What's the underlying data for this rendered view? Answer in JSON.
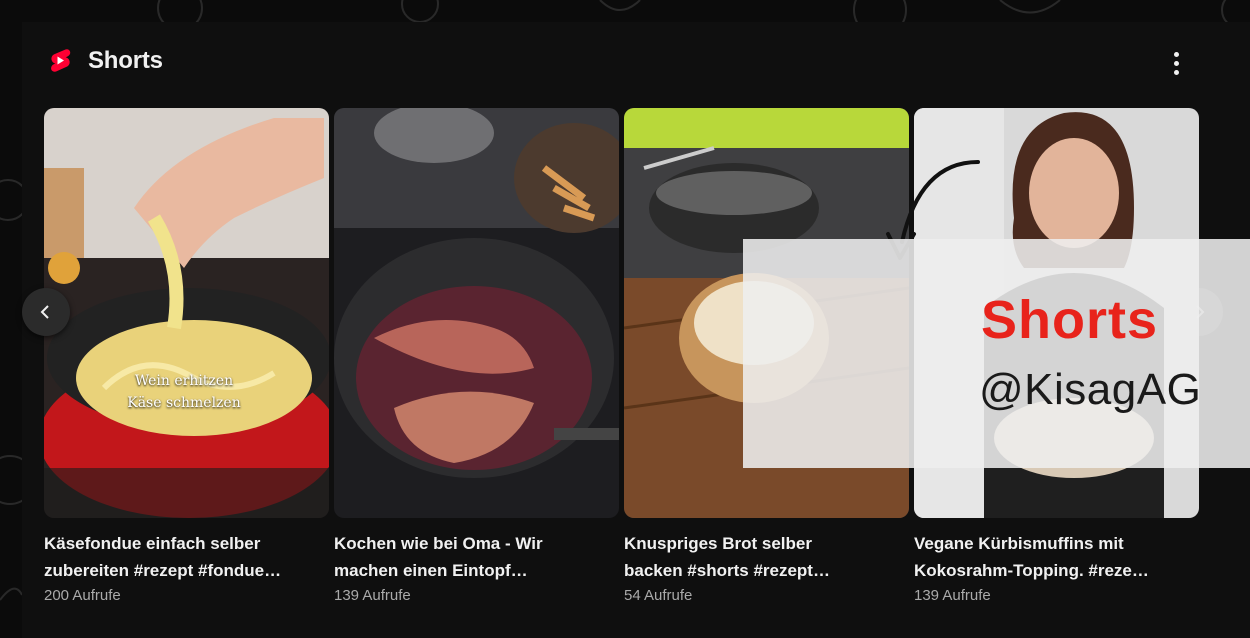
{
  "header": {
    "title": "Shorts",
    "logo_icon": "youtube-shorts-icon",
    "more_icon": "more-vertical-icon",
    "accent_color": "#ff0033"
  },
  "nav": {
    "prev_icon": "chevron-left-icon",
    "next_icon": "chevron-right-icon"
  },
  "cards": [
    {
      "title_line1": "Käsefondue einfach selber",
      "title_line2": "zubereiten #rezept #fondue…",
      "views": "200 Aufrufe",
      "thumb_caption_line1": "Wein erhitzen",
      "thumb_caption_line2": "Käse schmelzen"
    },
    {
      "title_line1": "Kochen wie bei Oma - Wir",
      "title_line2": "machen einen Eintopf…",
      "views": "139 Aufrufe"
    },
    {
      "title_line1": "Knuspriges Brot selber",
      "title_line2": "backen #shorts #rezept…",
      "views": "54 Aufrufe"
    },
    {
      "title_line1": "Vegane Kürbismuffins mit",
      "title_line2": "Kokosrahm-Topping. #reze…",
      "views": "139 Aufrufe"
    }
  ],
  "overlay": {
    "brand": "Shorts",
    "handle": "@KisagAG",
    "brand_color": "#e8231b"
  }
}
